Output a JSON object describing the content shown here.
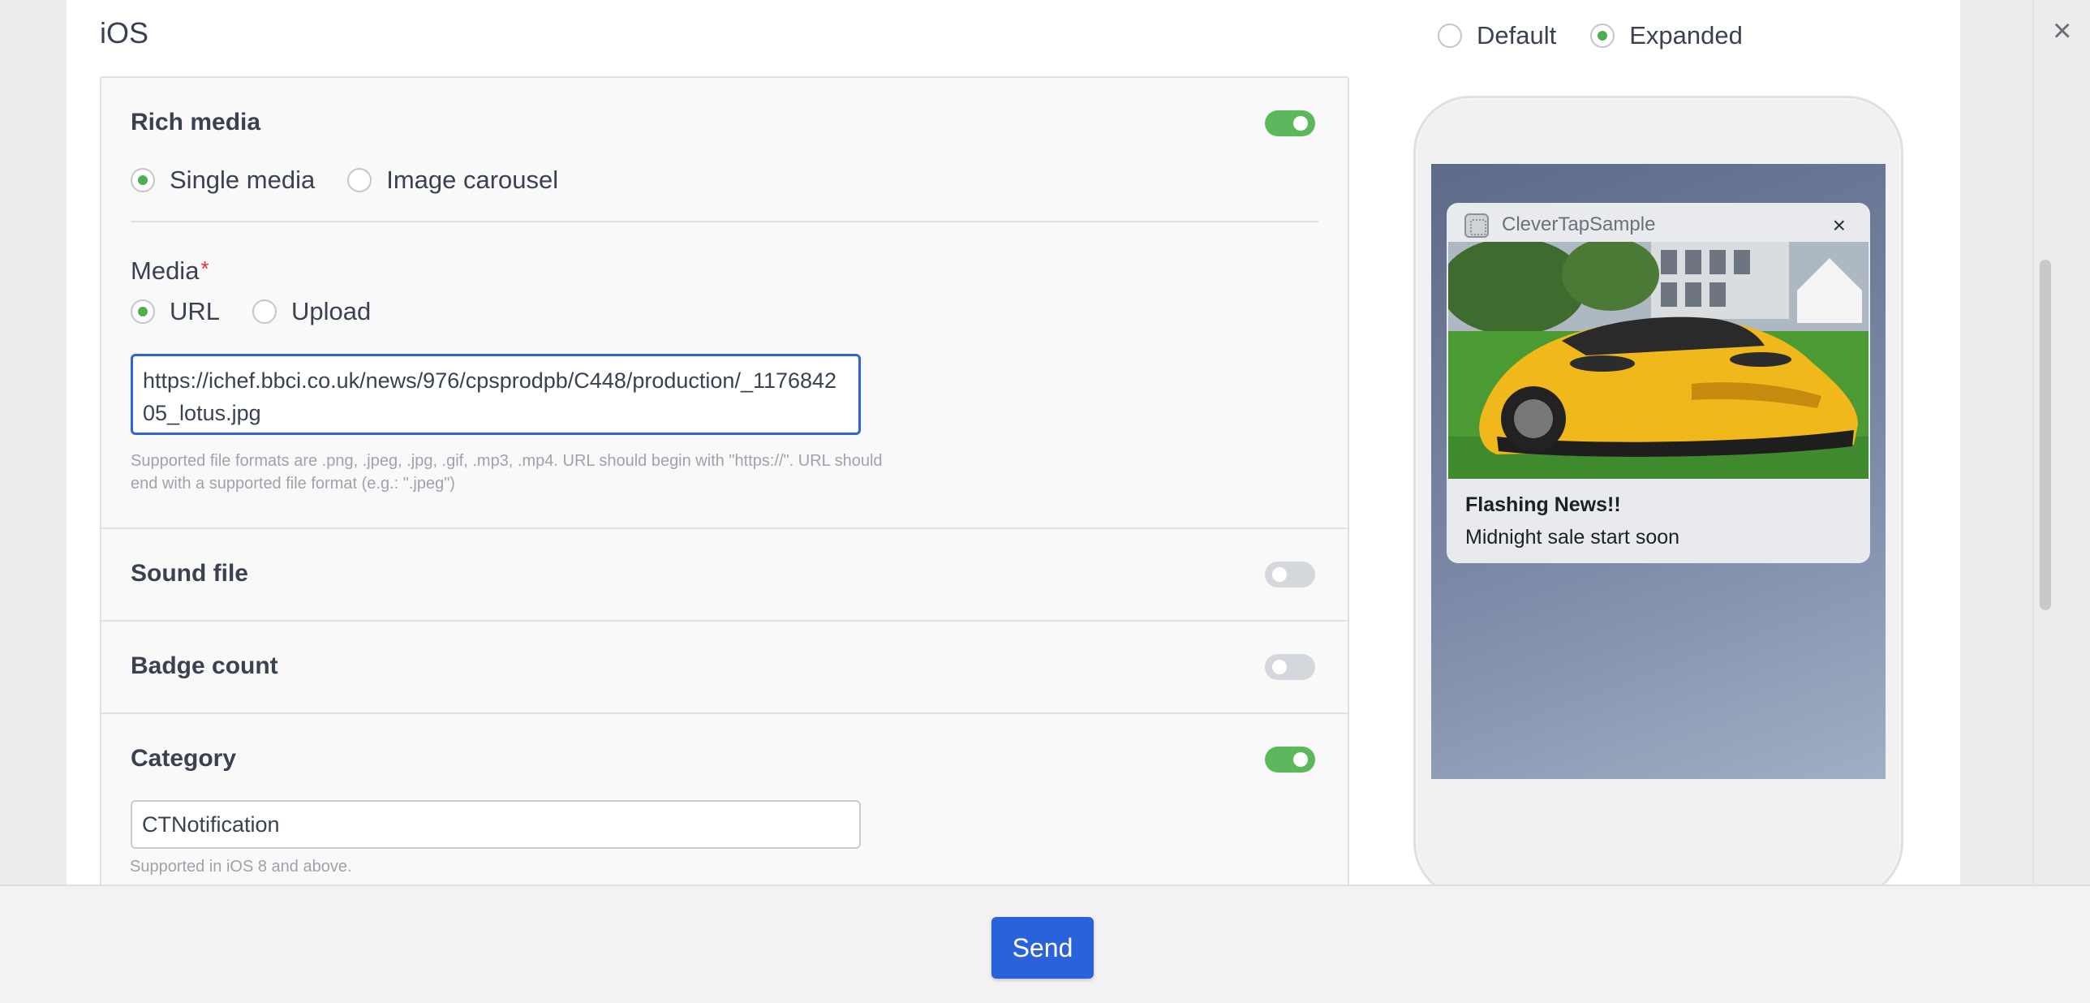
{
  "page": {
    "title": "iOS",
    "close_symbol": "×"
  },
  "preview_mode": {
    "options": [
      "Default",
      "Expanded"
    ],
    "selected": "Expanded"
  },
  "rich_media": {
    "title": "Rich media",
    "enabled": true,
    "type_options": [
      "Single media",
      "Image carousel"
    ],
    "type_selected": "Single media",
    "media_label": "Media",
    "required_marker": "*",
    "source_options": [
      "URL",
      "Upload"
    ],
    "source_selected": "URL",
    "url_value": "https://ichef.bbci.co.uk/news/976/cpsprodpb/C448/production/_117684205_lotus.jpg",
    "help_text": "Supported file formats are .png, .jpeg, .jpg, .gif, .mp3, .mp4. URL should begin with \"https://\". URL should end with a supported file format (e.g.: \".jpeg\")"
  },
  "sound_file": {
    "title": "Sound file",
    "enabled": false
  },
  "badge_count": {
    "title": "Badge count",
    "enabled": false
  },
  "category": {
    "title": "Category",
    "enabled": true,
    "value": "CTNotification",
    "help_text": "Supported in iOS 8 and above."
  },
  "notification_preview": {
    "app_name": "CleverTapSample",
    "close_symbol": "×",
    "title": "Flashing News!!",
    "body": "Midnight sale start soon",
    "image_description": "yellow sports car on grass"
  },
  "footer": {
    "send_label": "Send"
  },
  "colors": {
    "accent_blue": "#2a62dc",
    "toggle_on": "#5cb85c",
    "toggle_off": "#d4d7dc",
    "radio_dot": "#4caf50",
    "required_red": "#e5322d"
  }
}
